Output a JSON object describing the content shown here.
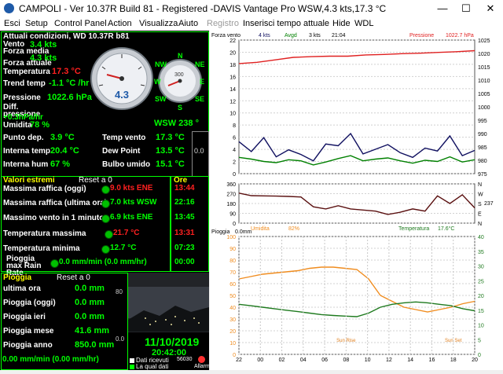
{
  "window": {
    "title": "CAMPOLI - Ver 10.37R Build 81 - Registered  -DAVIS Vantage Pro WSW,4.3 kts,17.3 °C",
    "minimize": "—",
    "maximize": "☐",
    "close": "✕"
  },
  "menu": [
    "Esci",
    "Setup",
    "Control Panel",
    "Action",
    "Visualizza",
    "Aiuto",
    "Registro",
    "Inserisci tempo attuale",
    "Hide",
    "WDL"
  ],
  "menu_disabled": "Registro",
  "current": {
    "header": "Attuali condizioni, WD 10.37R b81",
    "vento_label": "Vento",
    "vento_value": "3.4 kts",
    "forza_media_label": "Forza media",
    "forza_media_value": "4.3 kts",
    "forza_attuale_label": "Forza attuale",
    "temperatura_label": "Temperatura",
    "temperatura_value": "17.3 °C",
    "trend_label": "Trend temp",
    "trend_value": "-1.1 °C /hr",
    "pressione_label": "Pressione",
    "pressione_value": "1022.6 hPa",
    "diff_label": "Diff. pressione",
    "diff_value": "+0.3hPa/hr",
    "umidita_label": "Umidita",
    "umidita_value": "78 %",
    "wind_dir": "WSW  238 °",
    "punto_label": "Punto dep.",
    "punto_value": "3.9 °C",
    "temp_vento_label": "Temp vento",
    "temp_vento_value": "17.3 °C",
    "interna_temp_label": "Interna temp.",
    "interna_temp_value": "20.4 °C",
    "dew_label": "Dew Point",
    "dew_value": "13.5 °C",
    "interna_hum_label": "Interna hum",
    "interna_hum_value": "67 %",
    "bulbo_label": "Bulbo umido",
    "bulbo_value": "15.1 °C",
    "side_value": "0.0",
    "gauge_value": "4.3",
    "compass": {
      "N": "N",
      "S": "S",
      "E": "E",
      "W": "W",
      "NW": "NW",
      "NE": "NE",
      "SW": "SW",
      "SE": "SE"
    },
    "compass_level": "300"
  },
  "extremes": {
    "header": "Valori estremi",
    "reset_label": "Reset a 0",
    "ore_header": "Ore",
    "rows": [
      {
        "label": "Massima raffica (oggi)",
        "value": "9.0 kts ENE",
        "time": "13:44",
        "red": true
      },
      {
        "label": "Massima raffica (ultima ora)",
        "value": "7.0 kts WSW",
        "time": "22:16",
        "red": false
      },
      {
        "label": "Massimo vento in 1 minuto",
        "value": "6.9 kts ENE",
        "time": "13:45",
        "red": false
      },
      {
        "label": "Temperatura massima",
        "value": "21.7 °C",
        "time": "13:31",
        "red": true
      },
      {
        "label": "Temperatura minima",
        "value": "12.7 °C",
        "time": "07:23",
        "red": false
      },
      {
        "label": "Pioggia max Rain Rate",
        "value": "0.0 mm/min (0.0 mm/hr)",
        "time": "00:00",
        "red": false
      }
    ]
  },
  "rain": {
    "header": "Pioggia",
    "reset_label": "Reset a 0",
    "rows": [
      {
        "label": "ultima ora",
        "value": "0.0 mm"
      },
      {
        "label": "Pioggia (oggi)",
        "value": "0.0 mm"
      },
      {
        "label": "Pioggia ieri",
        "value": "0.0 mm"
      },
      {
        "label": "Pioggia mese",
        "value": "41.6 mm"
      },
      {
        "label": "Pioggia anno",
        "value": "850.0 mm"
      }
    ],
    "rate": "0.00 mm/min (0.00 mm/hr)"
  },
  "webcam": {
    "date": "11/10/2019",
    "time": "20:42:00",
    "counter": "56030",
    "legend_received": "Dati ricevuti",
    "legend_what": "La qual dati",
    "status": "Allarm",
    "scale_top": "80",
    "scale_bottom": "0.0",
    "status_color": "#ff3030"
  },
  "chart_data": [
    {
      "type": "line",
      "title": "",
      "header": {
        "label": "Forza vento",
        "kts1": "4 kts",
        "avg_label": "Avgd",
        "kts2": "3 kts",
        "time": "21:04",
        "press_label": "Pressione",
        "press_value": "1022.7 hPa"
      },
      "x": [
        "22",
        "00",
        "02",
        "04",
        "06",
        "08",
        "10",
        "12",
        "14",
        "16",
        "18",
        "20"
      ],
      "left_axis": {
        "ticks": [
          "22",
          "20",
          "18",
          "16",
          "14",
          "12",
          "10",
          "8",
          "6",
          "4",
          "2",
          "0"
        ],
        "range": [
          0,
          23
        ]
      },
      "right_axis": {
        "ticks": [
          "1025",
          "1020",
          "1015",
          "1010",
          "1005",
          "1000",
          "995",
          "990",
          "985",
          "980",
          "975"
        ],
        "range": [
          973,
          1027
        ]
      },
      "series": [
        {
          "name": "Pressione",
          "color": "#e02020",
          "values": [
            1017.5,
            1018.0,
            1019.0,
            1020.0,
            1020.3,
            1020.5,
            1020.5,
            1021.0,
            1021.2,
            1021.5,
            1021.7,
            1022.0,
            1022.3,
            1022.7
          ]
        },
        {
          "name": "",
          "color": "#101060",
          "values": [
            5.5,
            3.8,
            6.2,
            2.9,
            4.1,
            3.3,
            2.2,
            5.1,
            4.8,
            6.9,
            3.4,
            4.2,
            5.0,
            3.6,
            2.8,
            4.4,
            3.9,
            6.5,
            3.1,
            4.0
          ]
        },
        {
          "name": "",
          "color": "#008000",
          "values": [
            2.8,
            2.5,
            2.1,
            1.9,
            2.4,
            2.2,
            1.5,
            2.0,
            2.6,
            3.1,
            2.2,
            2.5,
            2.7,
            2.2,
            1.8,
            2.3,
            2.1,
            2.9,
            2.0,
            2.4
          ]
        }
      ]
    },
    {
      "type": "line",
      "title": "",
      "header": {
        "left_label": "Umidita",
        "left_value": "82%",
        "right_label": "Temperatura",
        "right_value": "17.6°C"
      },
      "x": [
        "22",
        "00",
        "02",
        "04",
        "06",
        "08",
        "10",
        "12",
        "14",
        "16",
        "18",
        "20"
      ],
      "left_axis": {
        "ticks": [
          "360",
          "270",
          "180",
          "90",
          "0"
        ],
        "range": [
          0,
          360
        ]
      },
      "right_axis": {
        "ticks": [
          "N",
          "W",
          "S",
          "E",
          "N"
        ]
      },
      "wind_dir_value": "237",
      "series": [
        {
          "name": "",
          "color": "#5a1010",
          "values": [
            275,
            252,
            250,
            248,
            245,
            240,
            150,
            130,
            160,
            130,
            120,
            110,
            80,
            100,
            130,
            110,
            250,
            180,
            260,
            140
          ]
        }
      ]
    },
    {
      "type": "line",
      "title": "",
      "header": {
        "label": "Pioggia",
        "value": "0.0mm"
      },
      "x": [
        "22",
        "00",
        "02",
        "04",
        "06",
        "08",
        "10",
        "12",
        "14",
        "16",
        "18",
        "20"
      ],
      "left_axis": {
        "ticks": [
          "100",
          "90",
          "80",
          "70",
          "60",
          "50",
          "40",
          "30",
          "20",
          "10",
          "0"
        ],
        "range": [
          0,
          100
        ]
      },
      "right_axis": {
        "ticks": [
          "40",
          "35",
          "30",
          "25",
          "20",
          "15",
          "10",
          "5",
          "0"
        ],
        "range": [
          0,
          40
        ]
      },
      "annotations": [
        {
          "text": "Sun Rise",
          "at": "08"
        },
        {
          "text": "Sun Set",
          "at": "18"
        }
      ],
      "series": [
        {
          "name": "",
          "color": "#f08c1e",
          "values": [
            64,
            66,
            68,
            69,
            70,
            71,
            73,
            74,
            74,
            73,
            72,
            64,
            50,
            45,
            40,
            38,
            36,
            38,
            40,
            43,
            45
          ]
        },
        {
          "name": "",
          "color": "#1e7a1e",
          "values": [
            17,
            16.5,
            16,
            15.5,
            15,
            14.5,
            14,
            13.5,
            13.2,
            13,
            12.8,
            14,
            16,
            17,
            17.5,
            17.8,
            17.5,
            17,
            16.5,
            15.5,
            14.8
          ]
        }
      ]
    }
  ]
}
